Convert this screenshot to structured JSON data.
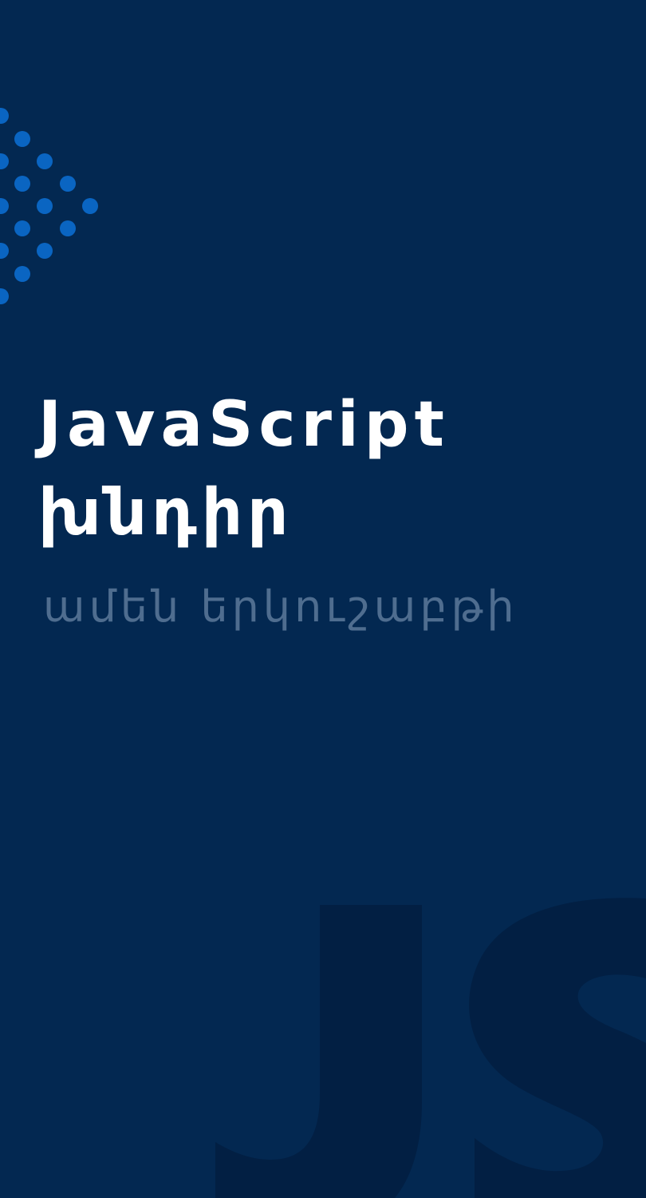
{
  "card": {
    "title_line_1": "JavaScript",
    "title_line_2": "խնդիր",
    "subtitle": "ամեն երկուշաբթի",
    "watermark_text": "JS"
  },
  "colors": {
    "background": "#032851",
    "dots": "#0a65c2",
    "title": "#ffffff",
    "subtitle": "#4f6d8f",
    "watermark": "#021f43"
  },
  "icons": {
    "decoration": "dot-pattern-icon",
    "watermark": "js-logo-watermark-icon"
  }
}
